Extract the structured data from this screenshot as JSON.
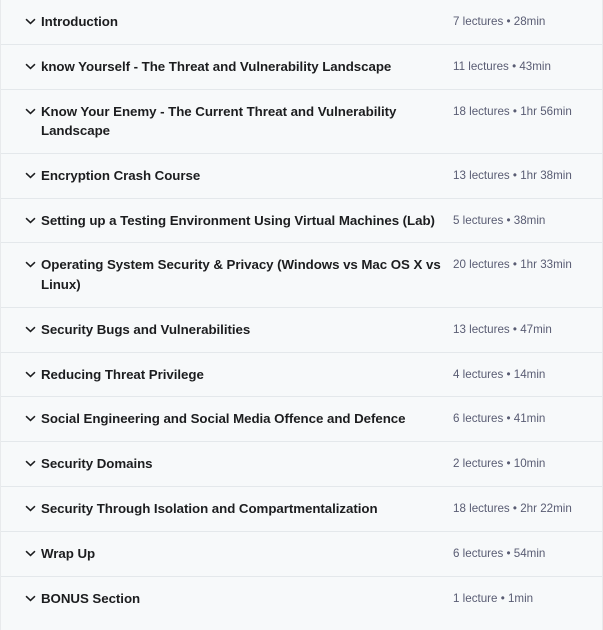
{
  "widget": {
    "name": "course-curriculum-accordion",
    "colors": {
      "background": "#f7f9fa",
      "divider": "#e4e8eb",
      "title_text": "#1c1d1f",
      "meta_text": "#595c73"
    },
    "chevron_icon": "chevron-down-icon"
  },
  "sections": [
    {
      "title": "Introduction",
      "lectures": "7 lectures",
      "duration": "28min",
      "meta": "7 lectures • 28min",
      "expanded": false
    },
    {
      "title": "know Yourself - The Threat and Vulnerability Landscape",
      "lectures": "11 lectures",
      "duration": "43min",
      "meta": "11 lectures • 43min",
      "expanded": false
    },
    {
      "title": "Know Your Enemy - The Current Threat and Vulnerability Landscape",
      "lectures": "18 lectures",
      "duration": "1hr 56min",
      "meta": "18 lectures • 1hr 56min",
      "expanded": false
    },
    {
      "title": "Encryption Crash Course",
      "lectures": "13 lectures",
      "duration": "1hr 38min",
      "meta": "13 lectures • 1hr 38min",
      "expanded": false
    },
    {
      "title": "Setting up a Testing Environment Using Virtual Machines (Lab)",
      "lectures": "5 lectures",
      "duration": "38min",
      "meta": "5 lectures • 38min",
      "expanded": false
    },
    {
      "title": "Operating System Security & Privacy (Windows vs Mac OS X vs Linux)",
      "lectures": "20 lectures",
      "duration": "1hr 33min",
      "meta": "20 lectures • 1hr 33min",
      "expanded": false
    },
    {
      "title": "Security Bugs and Vulnerabilities",
      "lectures": "13 lectures",
      "duration": "47min",
      "meta": "13 lectures • 47min",
      "expanded": false
    },
    {
      "title": "Reducing Threat Privilege",
      "lectures": "4 lectures",
      "duration": "14min",
      "meta": "4 lectures • 14min",
      "expanded": false
    },
    {
      "title": "Social Engineering and Social Media Offence and Defence",
      "lectures": "6 lectures",
      "duration": "41min",
      "meta": "6 lectures • 41min",
      "expanded": false
    },
    {
      "title": "Security Domains",
      "lectures": "2 lectures",
      "duration": "10min",
      "meta": "2 lectures • 10min",
      "expanded": false
    },
    {
      "title": "Security Through Isolation and Compartmentalization",
      "lectures": "18 lectures",
      "duration": "2hr 22min",
      "meta": "18 lectures • 2hr 22min",
      "expanded": false
    },
    {
      "title": "Wrap Up",
      "lectures": "6 lectures",
      "duration": "54min",
      "meta": "6 lectures • 54min",
      "expanded": false
    },
    {
      "title": "BONUS Section",
      "lectures": "1 lecture",
      "duration": "1min",
      "meta": "1 lecture • 1min",
      "expanded": false
    }
  ]
}
